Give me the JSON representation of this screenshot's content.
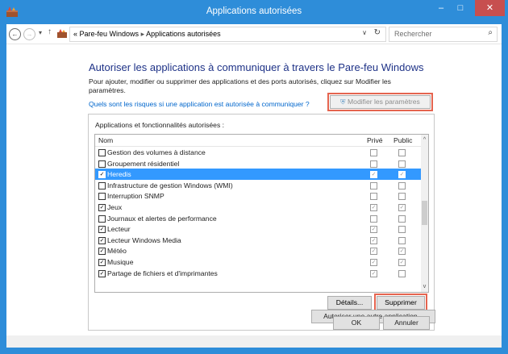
{
  "window": {
    "title": "Applications autorisées",
    "minimize_glyph": "–",
    "maximize_glyph": "□",
    "close_glyph": "✕"
  },
  "nav": {
    "back_glyph": "←",
    "forward_glyph": "→",
    "recent_glyph": "▾",
    "up_glyph": "↑",
    "breadcrumb_sep": "«",
    "crumb_1": "Pare-feu Windows",
    "crumb_arrow": "▸",
    "crumb_2": "Applications autorisées",
    "dropdown_glyph": "∨",
    "refresh_glyph": "↻",
    "search_placeholder": "Rechercher",
    "search_glyph": "⌕"
  },
  "content": {
    "heading": "Autoriser les applications à communiquer à travers le Pare-feu Windows",
    "intro": "Pour ajouter, modifier ou supprimer des applications et des ports autorisés, cliquez sur Modifier les paramètres.",
    "risk_link": "Quels sont les risques si une application est autorisée à communiquer ?",
    "modify_button": "Modifier les paramètres",
    "panel_label": "Applications et fonctionnalités autorisées :"
  },
  "list": {
    "columns": {
      "name": "Nom",
      "private": "Privé",
      "public": "Public"
    },
    "rows": [
      {
        "name": "Gestion des volumes à distance",
        "checked": false,
        "private": false,
        "public": false,
        "selected": false
      },
      {
        "name": "Groupement résidentiel",
        "checked": false,
        "private": false,
        "public": false,
        "selected": false
      },
      {
        "name": "Heredis",
        "checked": true,
        "private": true,
        "public": true,
        "selected": true
      },
      {
        "name": "Infrastructure de gestion Windows (WMI)",
        "checked": false,
        "private": false,
        "public": false,
        "selected": false
      },
      {
        "name": "Interruption SNMP",
        "checked": false,
        "private": false,
        "public": false,
        "selected": false
      },
      {
        "name": "Jeux",
        "checked": true,
        "private": true,
        "public": true,
        "selected": false
      },
      {
        "name": "Journaux et alertes de performance",
        "checked": false,
        "private": false,
        "public": false,
        "selected": false
      },
      {
        "name": "Lecteur",
        "checked": true,
        "private": true,
        "public": false,
        "selected": false
      },
      {
        "name": "Lecteur Windows Media",
        "checked": true,
        "private": true,
        "public": false,
        "selected": false
      },
      {
        "name": "Météo",
        "checked": true,
        "private": true,
        "public": true,
        "selected": false
      },
      {
        "name": "Musique",
        "checked": true,
        "private": true,
        "public": true,
        "selected": false
      },
      {
        "name": "Partage de fichiers et d'imprimantes",
        "checked": true,
        "private": true,
        "public": false,
        "selected": false
      }
    ],
    "scroll_up_glyph": "^",
    "scroll_down_glyph": "v",
    "check_glyph": "✓"
  },
  "buttons": {
    "details": "Détails...",
    "delete": "Supprimer",
    "allow_other": "Autoriser une autre application...",
    "ok": "OK",
    "cancel": "Annuler"
  },
  "colors": {
    "titlebar": "#2e8dd9",
    "selection": "#3399ff",
    "heading": "#1e3287",
    "link": "#0066cc",
    "highlight_outline": "#e5644f"
  }
}
